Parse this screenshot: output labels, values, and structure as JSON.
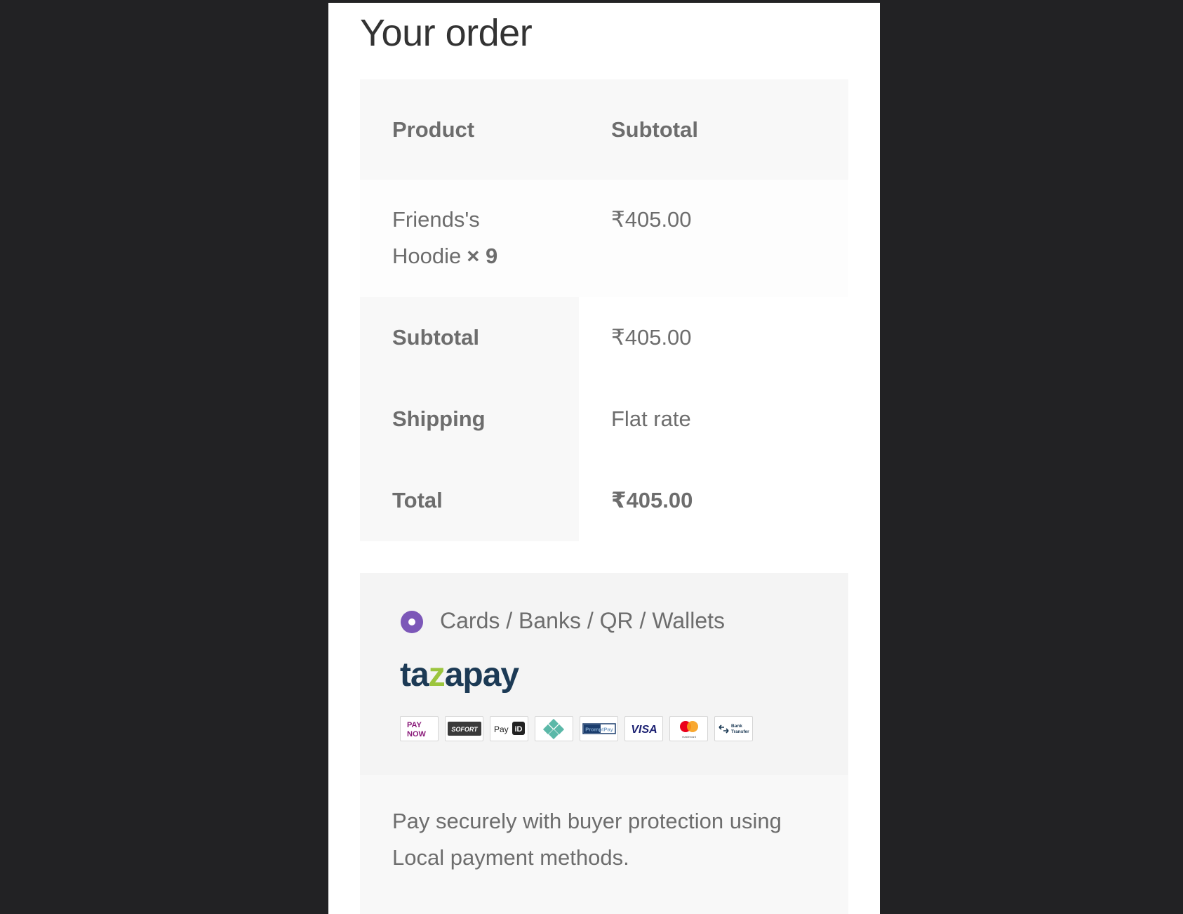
{
  "page": {
    "title": "Your order"
  },
  "table": {
    "headers": {
      "product": "Product",
      "subtotal": "Subtotal"
    },
    "items": [
      {
        "name_line1": "Friends's",
        "name_line2": "Hoodie",
        "quantity": "× 9",
        "subtotal": "₹405.00"
      }
    ],
    "totals": {
      "subtotal_label": "Subtotal",
      "subtotal_value": "₹405.00",
      "shipping_label": "Shipping",
      "shipping_value": "Flat rate",
      "total_label": "Total",
      "total_value": "₹405.00"
    }
  },
  "payment": {
    "method_label": "Cards / Banks / QR / Wallets",
    "selected": true,
    "brand_pre": "ta",
    "brand_z": "z",
    "brand_post": "apay",
    "logos": {
      "paynow_top": "PAY",
      "paynow_bottom": "NOW",
      "sofort": "SOFORT",
      "payid": "Pay",
      "payid_mark": "iD",
      "promptpay": "PromptPay",
      "visa": "VISA",
      "mastercard": "mastercard",
      "bank_top": "Bank",
      "bank_bottom": "Transfer"
    },
    "description": "Pay securely with buyer protection using Local payment methods."
  },
  "colors": {
    "radio_accent": "#7c57b8",
    "brand_navy": "#1c3a55",
    "brand_green": "#9bc53d"
  }
}
